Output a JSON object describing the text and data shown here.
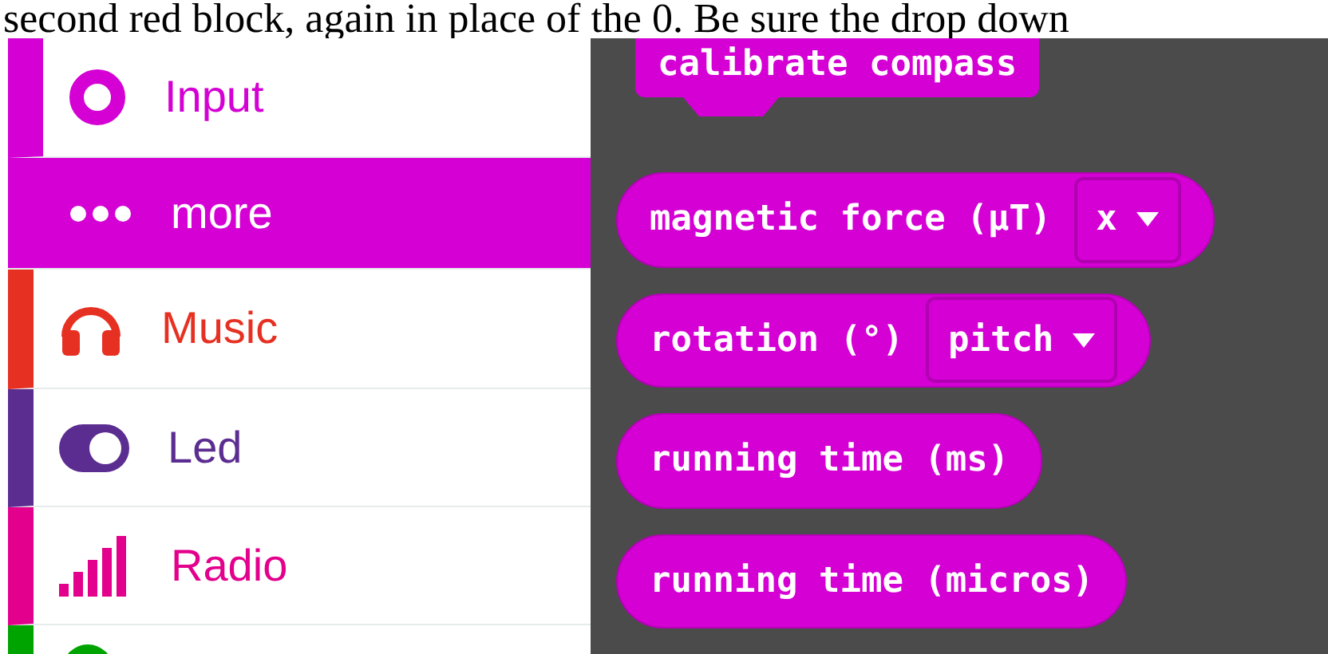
{
  "caption": "second red block, again in place of the 0. Be sure the drop down",
  "categories": [
    {
      "label": "Input",
      "kind": "input",
      "color": "#d400d4",
      "selected": false,
      "expanded": true,
      "children": [
        {
          "label": "more",
          "kind": "dots",
          "selected": true
        }
      ]
    },
    {
      "label": "Music",
      "kind": "headphones",
      "color": "#e63022",
      "selected": false,
      "expanded": false
    },
    {
      "label": "Led",
      "kind": "toggle",
      "color": "#5c2d91",
      "selected": false,
      "expanded": false
    },
    {
      "label": "Radio",
      "kind": "signal",
      "color": "#e3008c",
      "selected": false,
      "expanded": false
    },
    {
      "kind": "cut",
      "color": "#00a400",
      "selected": false,
      "expanded": false
    }
  ],
  "blocks": [
    {
      "label": "calibrate compass",
      "kind": "statement"
    },
    {
      "label": "magnetic force (µT)",
      "kind": "reporter",
      "dropdown": "x"
    },
    {
      "label": "rotation (°)",
      "kind": "reporter",
      "dropdown": "pitch"
    },
    {
      "label": "running time (ms)",
      "kind": "reporter"
    },
    {
      "label": "running time (micros)",
      "kind": "reporter"
    }
  ]
}
